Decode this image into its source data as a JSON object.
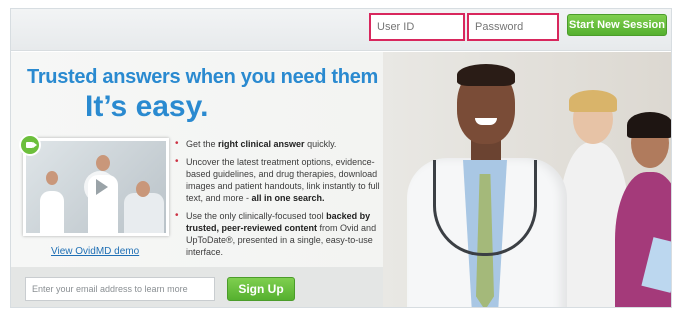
{
  "login": {
    "userid_placeholder": "User ID",
    "password_placeholder": "Password",
    "start_button": "Start New Session"
  },
  "hero": {
    "headline_line1": "Trusted answers when you need them –",
    "headline_line2": "It’s easy."
  },
  "video": {
    "demo_link": "View OvidMD demo"
  },
  "bullets": [
    {
      "pre": "Get the ",
      "bold": "right clinical answer",
      "post": " quickly."
    },
    {
      "pre": "Uncover the latest treatment options, evidence-based guidelines, and drug therapies, download images and patient handouts, link instantly to full text, and more - ",
      "bold": "all in one search.",
      "post": ""
    },
    {
      "pre": "Use the only clinically-focused tool ",
      "bold": "backed by trusted, peer-reviewed content",
      "post": " from Ovid and UpToDate®, presented in a single, easy-to-use interface."
    }
  ],
  "signup": {
    "email_placeholder": "Enter your email address to learn more",
    "button": "Sign Up"
  },
  "colors": {
    "headline": "#2a8ad0",
    "button_green": "#5fba36",
    "highlight_border": "#d8275d",
    "bullet_red": "#cc3344",
    "link_blue": "#1f6fb5"
  },
  "icons": {
    "video_camera": "camera-icon",
    "play": "play-icon"
  }
}
